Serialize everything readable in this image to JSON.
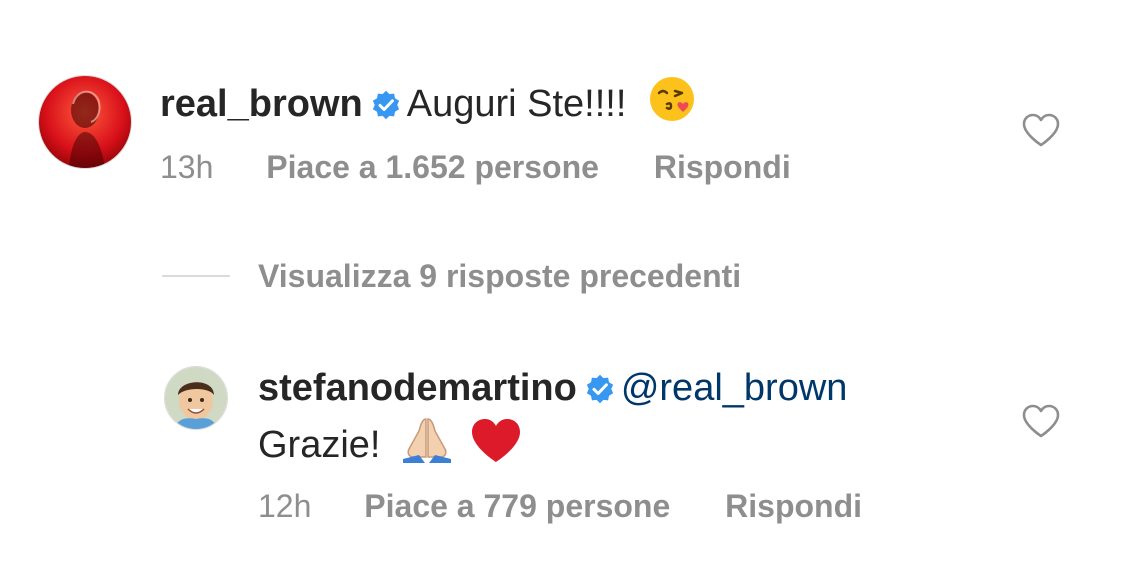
{
  "comments": [
    {
      "avatar": "avatar-red-portrait",
      "username": "real_brown",
      "verified": true,
      "text": "Auguri Ste!!!!",
      "emoji": "face-blowing-kiss-icon",
      "time": "13h",
      "likes": "Piace a 1.652 persone",
      "reply": "Rispondi",
      "liked": false
    },
    {
      "avatar": "avatar-smiling-child",
      "username": "stefanodemartino",
      "verified": true,
      "mention": "@real_brown",
      "text": "Grazie!",
      "emojis": [
        "folded-hands-icon",
        "red-heart-icon"
      ],
      "time": "12h",
      "likes": "Piace a 779 persone",
      "reply": "Rispondi",
      "liked": false
    }
  ],
  "view_replies": {
    "label": "Visualizza 9 risposte precedenti"
  },
  "colors": {
    "text_primary": "#262626",
    "text_secondary": "#8e8e8e",
    "mention": "#00376b",
    "verified_badge": "#3897f0",
    "divider": "#dbdbdb",
    "heart_red": "#ed4956"
  }
}
